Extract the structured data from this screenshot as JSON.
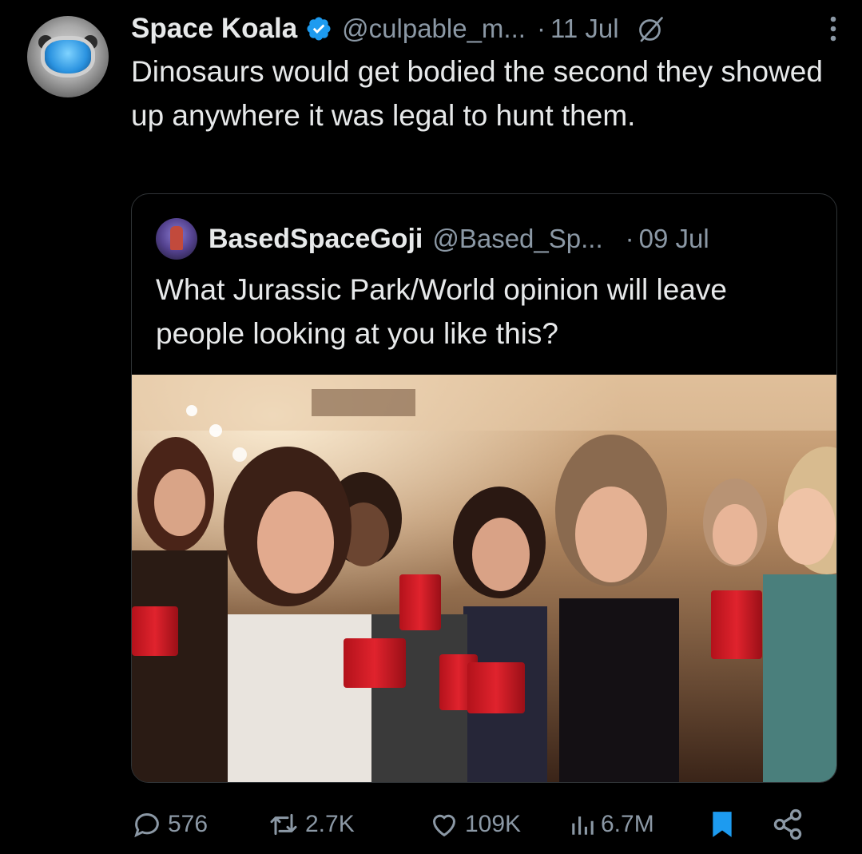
{
  "tweet": {
    "author_name": "Space Koala",
    "handle": "@culpable_m...",
    "separator": "·",
    "date": "11 Jul",
    "text": "Dinosaurs would get bodied the second they showed up anywhere it was legal to hunt them.",
    "icons": [
      "avatar",
      "verified-badge-icon",
      "grok-icon",
      "more-options-icon"
    ],
    "colors": {
      "verified": "#1d9bf0",
      "secondary_text": "#8b98a5",
      "bookmark": "#1d9bf0"
    }
  },
  "quoted_tweet": {
    "author_name": "BasedSpaceGoji",
    "handle": "@Based_Sp...",
    "separator": "·",
    "date": "09 Jul",
    "text": "What Jurassic Park/World opinion will leave people looking at you like this?",
    "image": "party-photo-people-with-red-cups"
  },
  "actions": {
    "reply_count": "576",
    "retweet_count": "2.7K",
    "like_count": "109K",
    "views_count": "6.7M",
    "icons": [
      "reply-icon",
      "retweet-icon",
      "like-icon",
      "views-icon",
      "bookmark-icon",
      "share-icon"
    ],
    "bookmarked": true
  }
}
